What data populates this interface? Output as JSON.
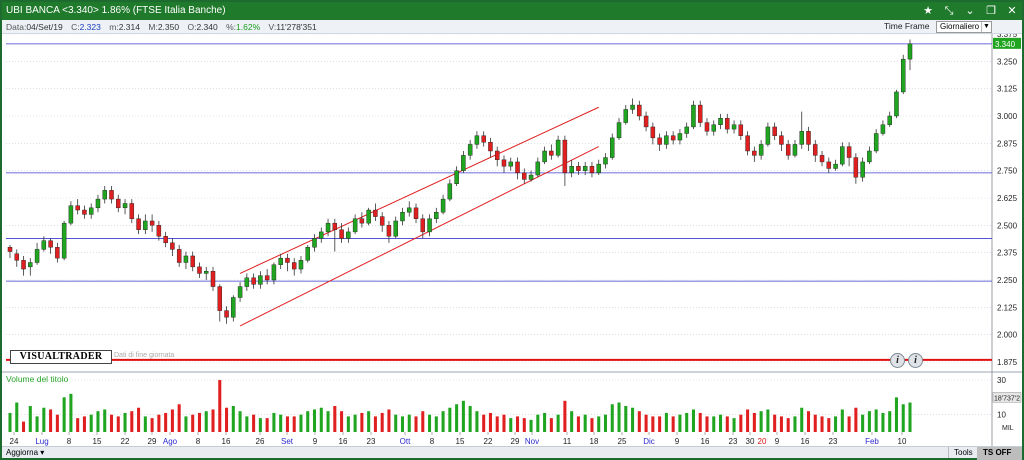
{
  "window": {
    "title": "UBI BANCA <3.340>  1.86%  (FTSE Italia Banche)",
    "controls": [
      "star-icon",
      "pin-icon",
      "collapse-icon",
      "restore-icon",
      "close-icon"
    ]
  },
  "infobar": {
    "date_label": "Data:",
    "date": "04/Set/19",
    "close_label": "C:",
    "close": "2.323",
    "min_label": "m:",
    "min": "2.314",
    "max_label": "M:",
    "max": "2.350",
    "open_label": "O:",
    "open": "2.340",
    "pct_label": "%:",
    "pct": "1.62%",
    "vol_label": "V:",
    "vol": "11'278'351"
  },
  "timeframe": {
    "label": "Time Frame",
    "value": "Giornaliero"
  },
  "brand": "VISUALTRADER",
  "brand_hint": "Dati di fine giornata",
  "volume_title": "Volume del titolo",
  "last_price_tag": "3.340",
  "last_volume_tag": "18'737'2",
  "volume_unit": "MIL",
  "bottom": {
    "aggiorna": "Aggiorna",
    "tools": "Tools",
    "tsoff": "TS OFF"
  },
  "colors": {
    "up": "#1fa51f",
    "down": "#e02020",
    "trend": "#e02020",
    "hline": "#3b3bd0",
    "frame": "#1f7a2c"
  },
  "chart_data": {
    "type": "candlestick",
    "price_axis_ticks": [
      "3.375",
      "3.250",
      "3.125",
      "3.000",
      "2.875",
      "2.750",
      "2.625",
      "2.500",
      "2.375",
      "2.250",
      "2.125",
      "2.000",
      "1.875"
    ],
    "ylim": [
      1.875,
      3.375
    ],
    "volume_axis_ticks": [
      "30",
      "10"
    ],
    "volume_ylim": [
      0,
      30
    ],
    "x_tick_labels": [
      "24",
      "Lug",
      "8",
      "15",
      "22",
      "29",
      "Ago",
      "8",
      "16",
      "26",
      "Set",
      "9",
      "16",
      "23",
      "Ott",
      "8",
      "15",
      "22",
      "29",
      "Nov",
      "11",
      "18",
      "25",
      "Dic",
      "9",
      "16",
      "23",
      "30",
      "9",
      "16",
      "23",
      "Feb",
      "10"
    ],
    "month_labels": [
      "Lug",
      "Ago",
      "Set",
      "Ott",
      "Nov",
      "Dic",
      "Feb"
    ],
    "year_label": "20",
    "horizontal_lines": [
      3.33,
      2.74,
      2.44,
      2.245
    ],
    "red_support_line": 1.885,
    "channel": {
      "upper": [
        [
          0.25,
          2.28
        ],
        [
          0.64,
          3.04
        ]
      ],
      "lower": [
        [
          0.25,
          2.04
        ],
        [
          0.64,
          2.86
        ]
      ]
    },
    "candles": [
      [
        2.4,
        2.38,
        2.41,
        2.35
      ],
      [
        2.37,
        2.34,
        2.39,
        2.31
      ],
      [
        2.34,
        2.3,
        2.36,
        2.27
      ],
      [
        2.31,
        2.33,
        2.35,
        2.27
      ],
      [
        2.33,
        2.39,
        2.42,
        2.32
      ],
      [
        2.39,
        2.43,
        2.45,
        2.38
      ],
      [
        2.43,
        2.4,
        2.44,
        2.37
      ],
      [
        2.4,
        2.35,
        2.42,
        2.33
      ],
      [
        2.35,
        2.51,
        2.52,
        2.34
      ],
      [
        2.51,
        2.59,
        2.61,
        2.5
      ],
      [
        2.59,
        2.57,
        2.62,
        2.55
      ],
      [
        2.57,
        2.55,
        2.59,
        2.53
      ],
      [
        2.55,
        2.58,
        2.6,
        2.53
      ],
      [
        2.58,
        2.62,
        2.64,
        2.56
      ],
      [
        2.62,
        2.66,
        2.68,
        2.6
      ],
      [
        2.66,
        2.62,
        2.68,
        2.6
      ],
      [
        2.62,
        2.58,
        2.64,
        2.56
      ],
      [
        2.58,
        2.6,
        2.62,
        2.55
      ],
      [
        2.6,
        2.53,
        2.62,
        2.51
      ],
      [
        2.53,
        2.48,
        2.55,
        2.46
      ],
      [
        2.48,
        2.52,
        2.55,
        2.46
      ],
      [
        2.52,
        2.5,
        2.55,
        2.47
      ],
      [
        2.5,
        2.45,
        2.52,
        2.43
      ],
      [
        2.45,
        2.42,
        2.47,
        2.4
      ],
      [
        2.42,
        2.39,
        2.44,
        2.36
      ],
      [
        2.39,
        2.33,
        2.41,
        2.31
      ],
      [
        2.33,
        2.36,
        2.38,
        2.3
      ],
      [
        2.36,
        2.31,
        2.38,
        2.29
      ],
      [
        2.31,
        2.28,
        2.33,
        2.26
      ],
      [
        2.28,
        2.29,
        2.31,
        2.25
      ],
      [
        2.29,
        2.22,
        2.31,
        2.2
      ],
      [
        2.22,
        2.11,
        2.23,
        2.06
      ],
      [
        2.11,
        2.08,
        2.13,
        2.05
      ],
      [
        2.08,
        2.17,
        2.18,
        2.06
      ],
      [
        2.17,
        2.22,
        2.24,
        2.15
      ],
      [
        2.22,
        2.26,
        2.28,
        2.2
      ],
      [
        2.26,
        2.23,
        2.28,
        2.21
      ],
      [
        2.23,
        2.27,
        2.29,
        2.21
      ],
      [
        2.27,
        2.25,
        2.3,
        2.23
      ],
      [
        2.25,
        2.32,
        2.33,
        2.23
      ],
      [
        2.32,
        2.35,
        2.37,
        2.3
      ],
      [
        2.35,
        2.33,
        2.37,
        2.29
      ],
      [
        2.33,
        2.3,
        2.35,
        2.27
      ],
      [
        2.3,
        2.34,
        2.36,
        2.28
      ],
      [
        2.34,
        2.4,
        2.41,
        2.33
      ],
      [
        2.4,
        2.44,
        2.46,
        2.38
      ],
      [
        2.44,
        2.47,
        2.49,
        2.42
      ],
      [
        2.47,
        2.51,
        2.53,
        2.45
      ],
      [
        2.51,
        2.48,
        2.53,
        2.38
      ],
      [
        2.48,
        2.44,
        2.51,
        2.42
      ],
      [
        2.44,
        2.47,
        2.49,
        2.42
      ],
      [
        2.47,
        2.53,
        2.55,
        2.46
      ],
      [
        2.53,
        2.51,
        2.56,
        2.49
      ],
      [
        2.51,
        2.57,
        2.58,
        2.5
      ],
      [
        2.57,
        2.54,
        2.6,
        2.52
      ],
      [
        2.54,
        2.5,
        2.56,
        2.47
      ],
      [
        2.5,
        2.45,
        2.52,
        2.42
      ],
      [
        2.45,
        2.52,
        2.54,
        2.44
      ],
      [
        2.52,
        2.56,
        2.58,
        2.5
      ],
      [
        2.56,
        2.58,
        2.61,
        2.54
      ],
      [
        2.58,
        2.53,
        2.6,
        2.51
      ],
      [
        2.53,
        2.47,
        2.55,
        2.44
      ],
      [
        2.47,
        2.53,
        2.55,
        2.45
      ],
      [
        2.53,
        2.56,
        2.58,
        2.51
      ],
      [
        2.56,
        2.62,
        2.64,
        2.55
      ],
      [
        2.62,
        2.69,
        2.71,
        2.61
      ],
      [
        2.69,
        2.75,
        2.77,
        2.68
      ],
      [
        2.75,
        2.82,
        2.84,
        2.74
      ],
      [
        2.82,
        2.87,
        2.89,
        2.8
      ],
      [
        2.87,
        2.91,
        2.93,
        2.85
      ],
      [
        2.91,
        2.88,
        2.93,
        2.86
      ],
      [
        2.88,
        2.84,
        2.9,
        2.81
      ],
      [
        2.84,
        2.8,
        2.86,
        2.77
      ],
      [
        2.8,
        2.77,
        2.82,
        2.74
      ],
      [
        2.77,
        2.79,
        2.81,
        2.75
      ],
      [
        2.79,
        2.74,
        2.81,
        2.71
      ],
      [
        2.74,
        2.71,
        2.76,
        2.69
      ],
      [
        2.71,
        2.73,
        2.75,
        2.7
      ],
      [
        2.73,
        2.79,
        2.81,
        2.72
      ],
      [
        2.79,
        2.84,
        2.86,
        2.78
      ],
      [
        2.84,
        2.82,
        2.87,
        2.8
      ],
      [
        2.82,
        2.89,
        2.91,
        2.81
      ],
      [
        2.89,
        2.74,
        2.91,
        2.68
      ],
      [
        2.74,
        2.77,
        2.8,
        2.72
      ],
      [
        2.77,
        2.75,
        2.79,
        2.73
      ],
      [
        2.75,
        2.77,
        2.79,
        2.73
      ],
      [
        2.77,
        2.74,
        2.79,
        2.72
      ],
      [
        2.74,
        2.78,
        2.8,
        2.73
      ],
      [
        2.78,
        2.81,
        2.83,
        2.76
      ],
      [
        2.81,
        2.9,
        2.92,
        2.8
      ],
      [
        2.9,
        2.97,
        2.99,
        2.89
      ],
      [
        2.97,
        3.03,
        3.05,
        2.96
      ],
      [
        3.03,
        3.05,
        3.08,
        3.01
      ],
      [
        3.05,
        3.0,
        3.07,
        2.98
      ],
      [
        3.0,
        2.95,
        3.02,
        2.93
      ],
      [
        2.95,
        2.9,
        2.97,
        2.87
      ],
      [
        2.9,
        2.87,
        2.92,
        2.84
      ],
      [
        2.87,
        2.91,
        2.93,
        2.85
      ],
      [
        2.91,
        2.89,
        2.93,
        2.87
      ],
      [
        2.89,
        2.92,
        2.94,
        2.87
      ],
      [
        2.92,
        2.95,
        2.97,
        2.9
      ],
      [
        2.95,
        3.05,
        3.07,
        2.94
      ],
      [
        3.05,
        2.97,
        3.07,
        2.95
      ],
      [
        2.97,
        2.93,
        2.99,
        2.91
      ],
      [
        2.93,
        2.96,
        2.98,
        2.91
      ],
      [
        2.96,
        2.99,
        3.01,
        2.94
      ],
      [
        2.99,
        2.94,
        3.01,
        2.92
      ],
      [
        2.94,
        2.96,
        2.98,
        2.92
      ],
      [
        2.96,
        2.91,
        2.98,
        2.89
      ],
      [
        2.91,
        2.84,
        2.93,
        2.82
      ],
      [
        2.84,
        2.82,
        2.86,
        2.79
      ],
      [
        2.82,
        2.87,
        2.89,
        2.8
      ],
      [
        2.87,
        2.95,
        2.97,
        2.86
      ],
      [
        2.95,
        2.91,
        2.97,
        2.89
      ],
      [
        2.91,
        2.87,
        2.93,
        2.84
      ],
      [
        2.87,
        2.82,
        2.89,
        2.8
      ],
      [
        2.82,
        2.87,
        2.89,
        2.81
      ],
      [
        2.87,
        2.93,
        3.02,
        2.85
      ],
      [
        2.93,
        2.87,
        2.95,
        2.84
      ],
      [
        2.87,
        2.82,
        2.89,
        2.79
      ],
      [
        2.82,
        2.79,
        2.84,
        2.77
      ],
      [
        2.79,
        2.76,
        2.81,
        2.74
      ],
      [
        2.76,
        2.78,
        2.8,
        2.75
      ],
      [
        2.78,
        2.86,
        2.88,
        2.77
      ],
      [
        2.86,
        2.81,
        2.88,
        2.77
      ],
      [
        2.81,
        2.72,
        2.83,
        2.69
      ],
      [
        2.72,
        2.79,
        2.81,
        2.7
      ],
      [
        2.79,
        2.84,
        2.86,
        2.78
      ],
      [
        2.84,
        2.92,
        2.94,
        2.83
      ],
      [
        2.92,
        2.96,
        2.98,
        2.91
      ],
      [
        2.96,
        3.0,
        3.02,
        2.95
      ],
      [
        3.0,
        3.11,
        3.12,
        2.99
      ],
      [
        3.11,
        3.26,
        3.28,
        3.1
      ],
      [
        3.26,
        3.33,
        3.35,
        3.21
      ]
    ],
    "volumes": [
      [
        11,
        1
      ],
      [
        17,
        1
      ],
      [
        6,
        0
      ],
      [
        15,
        1
      ],
      [
        9,
        1
      ],
      [
        14,
        1
      ],
      [
        13,
        0
      ],
      [
        10,
        0
      ],
      [
        20,
        1
      ],
      [
        22,
        1
      ],
      [
        8,
        0
      ],
      [
        9,
        0
      ],
      [
        10,
        1
      ],
      [
        12,
        1
      ],
      [
        13,
        1
      ],
      [
        10,
        0
      ],
      [
        9,
        0
      ],
      [
        11,
        1
      ],
      [
        12,
        0
      ],
      [
        14,
        0
      ],
      [
        9,
        1
      ],
      [
        8,
        0
      ],
      [
        10,
        0
      ],
      [
        11,
        0
      ],
      [
        13,
        0
      ],
      [
        16,
        0
      ],
      [
        9,
        1
      ],
      [
        10,
        0
      ],
      [
        11,
        0
      ],
      [
        12,
        1
      ],
      [
        13,
        0
      ],
      [
        30,
        0
      ],
      [
        14,
        0
      ],
      [
        15,
        1
      ],
      [
        12,
        1
      ],
      [
        9,
        1
      ],
      [
        10,
        0
      ],
      [
        8,
        1
      ],
      [
        8,
        0
      ],
      [
        11,
        1
      ],
      [
        10,
        1
      ],
      [
        9,
        0
      ],
      [
        9,
        0
      ],
      [
        10,
        1
      ],
      [
        12,
        1
      ],
      [
        13,
        1
      ],
      [
        14,
        1
      ],
      [
        12,
        1
      ],
      [
        15,
        0
      ],
      [
        12,
        0
      ],
      [
        9,
        1
      ],
      [
        10,
        1
      ],
      [
        11,
        0
      ],
      [
        12,
        1
      ],
      [
        9,
        0
      ],
      [
        11,
        0
      ],
      [
        13,
        0
      ],
      [
        10,
        1
      ],
      [
        9,
        1
      ],
      [
        10,
        1
      ],
      [
        9,
        0
      ],
      [
        12,
        0
      ],
      [
        10,
        1
      ],
      [
        9,
        1
      ],
      [
        12,
        1
      ],
      [
        14,
        1
      ],
      [
        16,
        1
      ],
      [
        18,
        1
      ],
      [
        15,
        1
      ],
      [
        12,
        1
      ],
      [
        10,
        0
      ],
      [
        11,
        0
      ],
      [
        9,
        0
      ],
      [
        10,
        0
      ],
      [
        8,
        1
      ],
      [
        9,
        0
      ],
      [
        8,
        0
      ],
      [
        7,
        1
      ],
      [
        10,
        1
      ],
      [
        11,
        1
      ],
      [
        8,
        0
      ],
      [
        10,
        1
      ],
      [
        18,
        0
      ],
      [
        12,
        1
      ],
      [
        9,
        0
      ],
      [
        10,
        1
      ],
      [
        8,
        0
      ],
      [
        9,
        1
      ],
      [
        10,
        1
      ],
      [
        16,
        1
      ],
      [
        17,
        1
      ],
      [
        15,
        1
      ],
      [
        14,
        1
      ],
      [
        12,
        0
      ],
      [
        10,
        0
      ],
      [
        9,
        0
      ],
      [
        9,
        0
      ],
      [
        11,
        1
      ],
      [
        9,
        0
      ],
      [
        10,
        1
      ],
      [
        11,
        1
      ],
      [
        13,
        1
      ],
      [
        11,
        0
      ],
      [
        9,
        0
      ],
      [
        9,
        1
      ],
      [
        10,
        1
      ],
      [
        9,
        0
      ],
      [
        8,
        1
      ],
      [
        10,
        0
      ],
      [
        13,
        0
      ],
      [
        11,
        0
      ],
      [
        12,
        1
      ],
      [
        13,
        1
      ],
      [
        10,
        0
      ],
      [
        9,
        0
      ],
      [
        8,
        0
      ],
      [
        9,
        1
      ],
      [
        14,
        1
      ],
      [
        12,
        0
      ],
      [
        10,
        0
      ],
      [
        9,
        0
      ],
      [
        8,
        0
      ],
      [
        9,
        1
      ],
      [
        13,
        1
      ],
      [
        9,
        0
      ],
      [
        14,
        0
      ],
      [
        10,
        1
      ],
      [
        12,
        1
      ],
      [
        13,
        1
      ],
      [
        11,
        1
      ],
      [
        12,
        1
      ],
      [
        20,
        1
      ],
      [
        16,
        1
      ],
      [
        17,
        1
      ]
    ]
  }
}
